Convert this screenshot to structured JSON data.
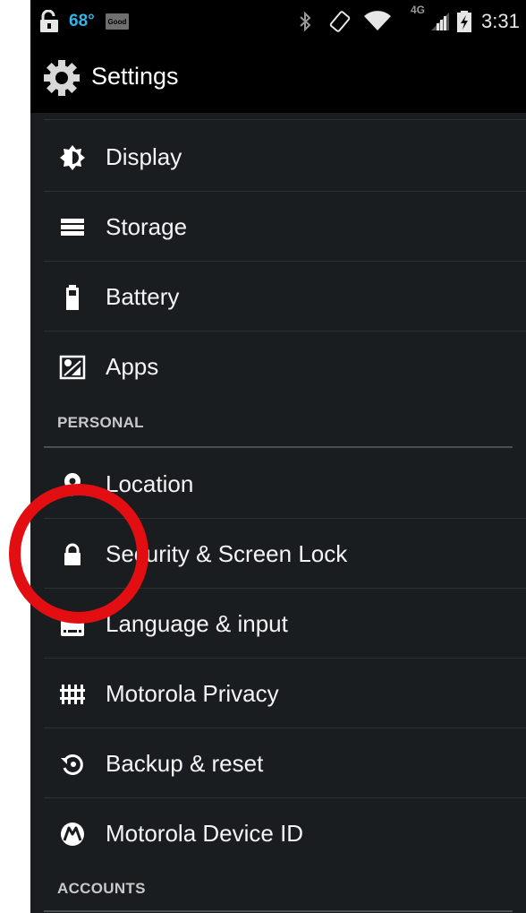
{
  "status_bar": {
    "temperature": "68°",
    "weather_badge": "Good",
    "network": "4G",
    "time": "3:31"
  },
  "action_bar": {
    "title": "Settings"
  },
  "items": [
    {
      "label": "Display",
      "icon": "display-icon"
    },
    {
      "label": "Storage",
      "icon": "storage-icon"
    },
    {
      "label": "Battery",
      "icon": "battery-icon"
    },
    {
      "label": "Apps",
      "icon": "apps-icon"
    },
    {
      "label": "Location",
      "icon": "location-icon"
    },
    {
      "label": "Security & Screen Lock",
      "icon": "lock-icon"
    },
    {
      "label": "Language & input",
      "icon": "keyboard-icon"
    },
    {
      "label": "Motorola Privacy",
      "icon": "privacy-icon"
    },
    {
      "label": "Backup & reset",
      "icon": "backup-icon"
    },
    {
      "label": "Motorola Device ID",
      "icon": "motorola-icon"
    }
  ],
  "sections": {
    "personal": "PERSONAL",
    "accounts": "ACCOUNTS"
  },
  "colors": {
    "background": "#1a1d20",
    "accent": "#33b5e5",
    "highlight_circle": "#e30e12"
  }
}
